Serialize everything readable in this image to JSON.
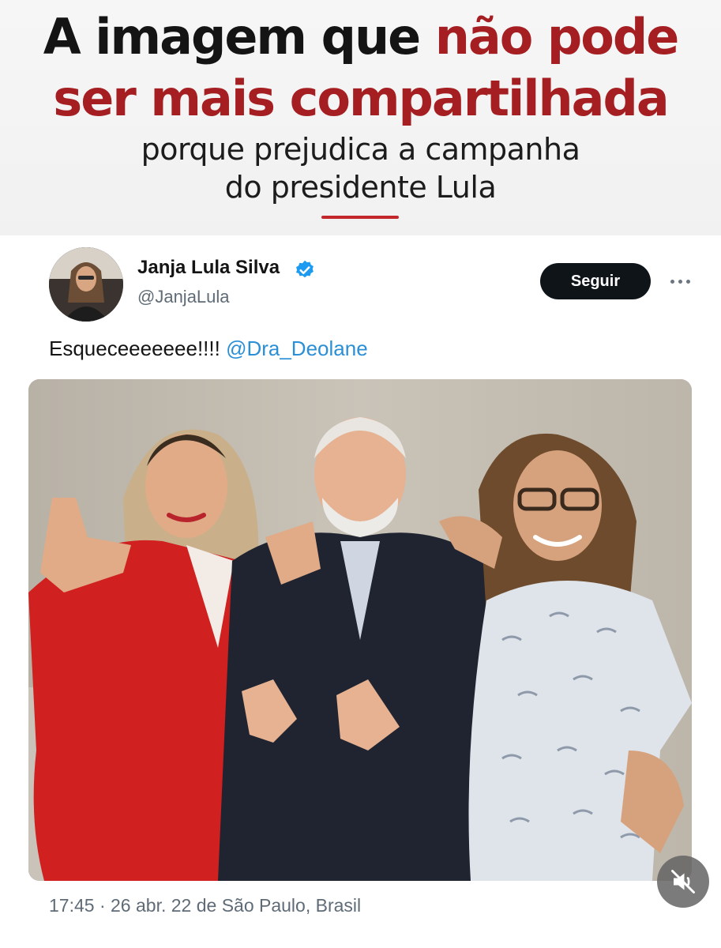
{
  "banner": {
    "headline_line1_dark": "A imagem que ",
    "headline_line1_red": "não pode",
    "headline_line2_red": "ser mais compartilhada",
    "subtitle_line1": "porque prejudica a campanha",
    "subtitle_line2": "do presidente Lula"
  },
  "tweet": {
    "author_name": "Janja Lula Silva",
    "author_handle": "@JanjaLula",
    "follow_label": "Seguir",
    "text": "Esqueceeeeeee!!!! ",
    "mention": "@Dra_Deolane",
    "time": "17:45",
    "separator": " · ",
    "date_location": "26 abr. 22 de São Paulo, Brasil"
  },
  "icons": {
    "verified": "verified-badge-icon",
    "more": "more-options-icon",
    "mute": "muted-speaker-icon"
  },
  "colors": {
    "headline_red": "#a51f22",
    "accent_line": "#c4272b",
    "mention_blue": "#2b8fd6",
    "follow_button": "#0f1419",
    "verified_blue": "#1d9bf0"
  }
}
